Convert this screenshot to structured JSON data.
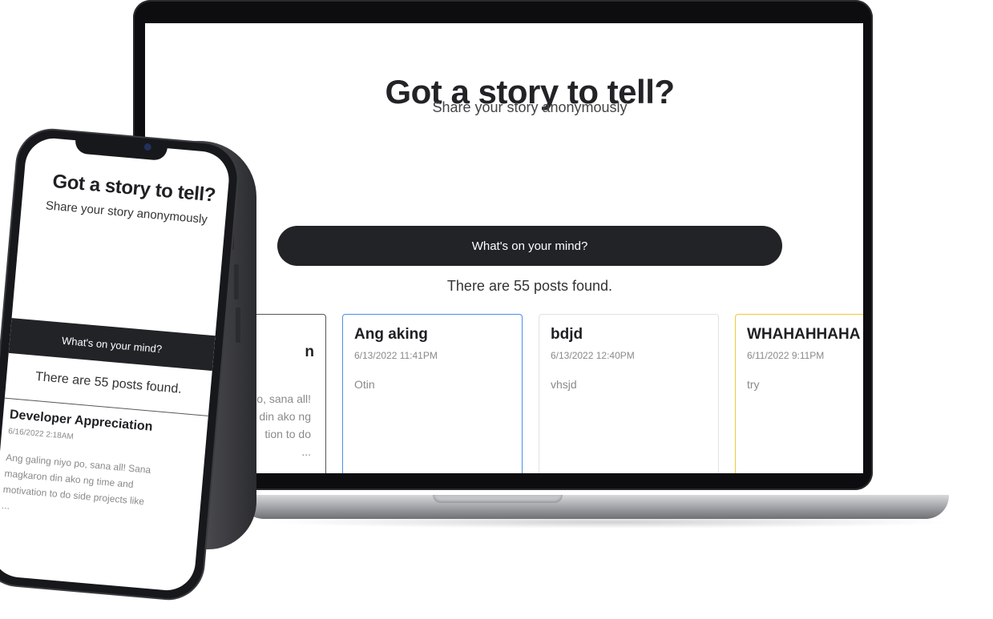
{
  "desktop": {
    "title": "Got a story to tell?",
    "subtitle": "Share your story anonymously",
    "mind_button": "What's on your mind?",
    "post_count": "There are 55 posts found.",
    "cards": [
      {
        "title": "n",
        "date": "",
        "body": [
          "o, sana all!",
          "din ako ng",
          "tion to do",
          "..."
        ],
        "border": "#555555"
      },
      {
        "title": "Ang aking",
        "date": "6/13/2022 11:41PM",
        "body": "Otin",
        "border": "#4a8fe7"
      },
      {
        "title": "bdjd",
        "date": "6/13/2022 12:40PM",
        "body": "vhsjd",
        "border": "#e1e1e1"
      },
      {
        "title": "WHAHAHHAHA",
        "date": "6/11/2022 9:11PM",
        "body": "try",
        "border": "#f2c83a"
      }
    ]
  },
  "mobile": {
    "title": "Got a story to tell?",
    "subtitle": "Share your story anonymously",
    "mind_button": "What's on your mind?",
    "post_count": "There are 55 posts found.",
    "card": {
      "title": "Developer Appreciation",
      "date": "6/16/2022 2:18AM",
      "body": "Ang galing niyo po, sana all! Sana magkaron din ako ng time and motivation to do side projects like ..."
    }
  },
  "colors": {
    "primary": "#222327",
    "accent_blue": "#4a8fe7",
    "accent_yellow": "#f2c83a",
    "muted_text": "#8a8a8a"
  }
}
